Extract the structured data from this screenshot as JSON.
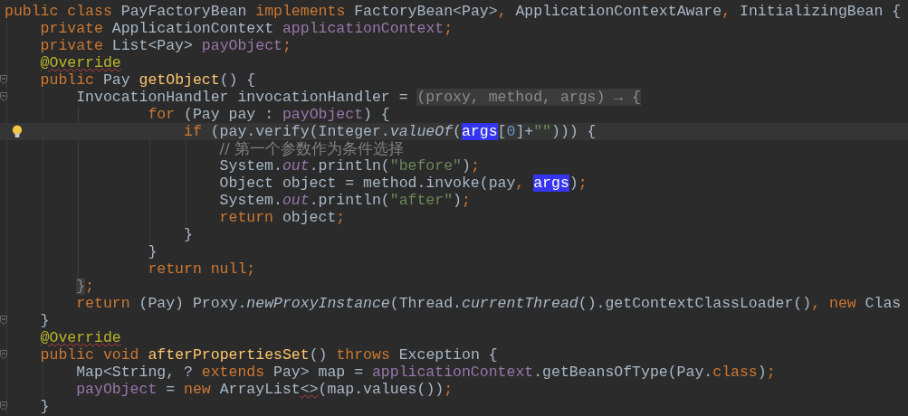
{
  "editor": {
    "lines": [
      {
        "tokens": [
          {
            "text": "public class",
            "kind": "keyword"
          },
          {
            "text": " PayFactoryBean ",
            "kind": "plain"
          },
          {
            "text": "implements",
            "kind": "keyword"
          },
          {
            "text": " FactoryBean<Pay>",
            "kind": "plain"
          },
          {
            "text": ",",
            "kind": "keyword"
          },
          {
            "text": " ApplicationContextAware",
            "kind": "plain"
          },
          {
            "text": ",",
            "kind": "keyword"
          },
          {
            "text": " InitializingBean {",
            "kind": "plain"
          }
        ],
        "children": [
          {
            "tokens": [
              {
                "text": "private",
                "kind": "keyword"
              },
              {
                "text": " ApplicationContext ",
                "kind": "plain"
              },
              {
                "text": "applicationContext",
                "kind": "field"
              },
              {
                "text": ";",
                "kind": "keyword"
              }
            ]
          },
          {
            "tokens": [
              {
                "text": "private",
                "kind": "keyword"
              },
              {
                "text": " List<Pay> ",
                "kind": "plain"
              },
              {
                "text": "payObject",
                "kind": "field"
              },
              {
                "text": ";",
                "kind": "keyword"
              }
            ]
          },
          {
            "tokens": [
              {
                "text": "@Override",
                "kind": "annotation",
                "warn": true
              }
            ]
          },
          {
            "fold": true,
            "tokens": [
              {
                "text": "public",
                "kind": "keyword"
              },
              {
                "text": " Pay ",
                "kind": "plain"
              },
              {
                "text": "getObject",
                "kind": "method"
              },
              {
                "text": "() {",
                "kind": "plain"
              }
            ],
            "children": [
              {
                "fold": true,
                "continuation": true,
                "tokens": [
                  {
                    "text": "InvocationHandler invocationHandler = ",
                    "kind": "plain"
                  },
                  {
                    "text": "(proxy, method, args) → {",
                    "kind": "folded"
                  }
                ],
                "children": [
                  {
                    "tokens": [
                      {
                        "text": "for",
                        "kind": "keyword"
                      },
                      {
                        "text": " (Pay pay : ",
                        "kind": "plain"
                      },
                      {
                        "text": "payObject",
                        "kind": "field"
                      },
                      {
                        "text": ") {",
                        "kind": "plain"
                      }
                    ],
                    "children": [
                      {
                        "current": true,
                        "bulb": true,
                        "tokens": [
                          {
                            "text": "if",
                            "kind": "keyword"
                          },
                          {
                            "text": " (pay.verify(Integer.",
                            "kind": "plain"
                          },
                          {
                            "text": "valueOf",
                            "kind": "static"
                          },
                          {
                            "text": "(",
                            "kind": "plain"
                          },
                          {
                            "text": "args",
                            "kind": "usage"
                          },
                          {
                            "text": "[",
                            "kind": "plain"
                          },
                          {
                            "text": "0",
                            "kind": "number"
                          },
                          {
                            "text": "]+",
                            "kind": "plain"
                          },
                          {
                            "text": "\"\"",
                            "kind": "string"
                          },
                          {
                            "text": "))) {",
                            "kind": "plain"
                          }
                        ],
                        "children": [
                          {
                            "tokens": [
                              {
                                "text": "// 第一个参数作为条件选择",
                                "kind": "comment"
                              }
                            ]
                          },
                          {
                            "tokens": [
                              {
                                "text": "System.",
                                "kind": "plain"
                              },
                              {
                                "text": "out",
                                "kind": "static-field"
                              },
                              {
                                "text": ".println(",
                                "kind": "plain"
                              },
                              {
                                "text": "\"before\"",
                                "kind": "string"
                              },
                              {
                                "text": ")",
                                "kind": "plain"
                              },
                              {
                                "text": ";",
                                "kind": "keyword"
                              }
                            ]
                          },
                          {
                            "tokens": [
                              {
                                "text": "Object object = method.invoke(pay",
                                "kind": "plain"
                              },
                              {
                                "text": ", ",
                                "kind": "keyword"
                              },
                              {
                                "text": "args",
                                "kind": "usage"
                              },
                              {
                                "text": ")",
                                "kind": "plain"
                              },
                              {
                                "text": ";",
                                "kind": "keyword"
                              }
                            ]
                          },
                          {
                            "tokens": [
                              {
                                "text": "System.",
                                "kind": "plain"
                              },
                              {
                                "text": "out",
                                "kind": "static-field"
                              },
                              {
                                "text": ".println(",
                                "kind": "plain"
                              },
                              {
                                "text": "\"after\"",
                                "kind": "string"
                              },
                              {
                                "text": ")",
                                "kind": "plain"
                              },
                              {
                                "text": ";",
                                "kind": "keyword"
                              }
                            ]
                          },
                          {
                            "tokens": [
                              {
                                "text": "return",
                                "kind": "keyword"
                              },
                              {
                                "text": " object",
                                "kind": "plain"
                              },
                              {
                                "text": ";",
                                "kind": "keyword"
                              }
                            ]
                          }
                        ]
                      },
                      {
                        "tokens": [
                          {
                            "text": "}",
                            "kind": "plain"
                          }
                        ]
                      }
                    ]
                  },
                  {
                    "tokens": [
                      {
                        "text": "}",
                        "kind": "plain"
                      }
                    ]
                  },
                  {
                    "tokens": [
                      {
                        "text": "return null;",
                        "kind": "keyword"
                      }
                    ]
                  }
                ]
              },
              {
                "tokens": [
                  {
                    "text": "}",
                    "kind": "folded"
                  },
                  {
                    "text": ";",
                    "kind": "keyword"
                  }
                ]
              },
              {
                "tokens": [
                  {
                    "text": "return",
                    "kind": "keyword"
                  },
                  {
                    "text": " (Pay) Proxy.",
                    "kind": "plain"
                  },
                  {
                    "text": "newProxyInstance",
                    "kind": "static"
                  },
                  {
                    "text": "(Thread.",
                    "kind": "plain"
                  },
                  {
                    "text": "currentThread",
                    "kind": "static"
                  },
                  {
                    "text": "().getContextClassLoader()",
                    "kind": "plain"
                  },
                  {
                    "text": ", new",
                    "kind": "keyword"
                  },
                  {
                    "text": " Clas",
                    "kind": "plain"
                  }
                ]
              }
            ]
          },
          {
            "fold": true,
            "tokens": [
              {
                "text": "}",
                "kind": "plain"
              }
            ]
          },
          {
            "tokens": [
              {
                "text": "@Override",
                "kind": "annotation",
                "warn": true
              }
            ]
          },
          {
            "fold": true,
            "tokens": [
              {
                "text": "public void ",
                "kind": "keyword"
              },
              {
                "text": "afterPropertiesSet",
                "kind": "method"
              },
              {
                "text": "() ",
                "kind": "plain"
              },
              {
                "text": "throws",
                "kind": "keyword"
              },
              {
                "text": " Exception {",
                "kind": "plain"
              }
            ],
            "children": [
              {
                "tokens": [
                  {
                    "text": "Map<String, ? ",
                    "kind": "plain"
                  },
                  {
                    "text": "extends",
                    "kind": "keyword"
                  },
                  {
                    "text": " Pay> map = ",
                    "kind": "plain"
                  },
                  {
                    "text": "applicationContext",
                    "kind": "field"
                  },
                  {
                    "text": ".getBeansOfType(Pay.",
                    "kind": "plain"
                  },
                  {
                    "text": "class",
                    "kind": "keyword"
                  },
                  {
                    "text": ")",
                    "kind": "plain"
                  },
                  {
                    "text": ";",
                    "kind": "keyword"
                  }
                ]
              },
              {
                "tokens": [
                  {
                    "text": "payObject",
                    "kind": "field"
                  },
                  {
                    "text": " = ",
                    "kind": "plain"
                  },
                  {
                    "text": "new",
                    "kind": "keyword"
                  },
                  {
                    "text": " ArrayList",
                    "kind": "plain"
                  },
                  {
                    "text": "<>",
                    "kind": "plain",
                    "warn": true
                  },
                  {
                    "text": "(map.values())",
                    "kind": "plain"
                  },
                  {
                    "text": ";",
                    "kind": "keyword"
                  }
                ]
              }
            ]
          },
          {
            "fold": true,
            "tokens": [
              {
                "text": "}",
                "kind": "plain"
              }
            ]
          }
        ]
      }
    ]
  }
}
